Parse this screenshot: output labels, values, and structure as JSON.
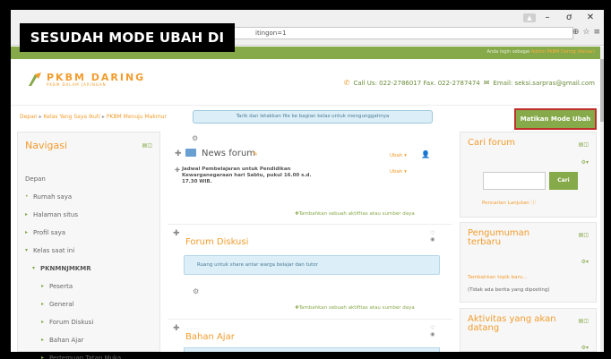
{
  "caption": "SESUDAH MODE UBAH DI KLIK",
  "browser": {
    "address_text": "itingon=1",
    "minimize": "–",
    "maximize": "ơ",
    "close": "✕"
  },
  "topbar": {
    "login_prefix": "Anda login sebagai",
    "login_user": "Admin PKBM Daring (Keluar)"
  },
  "header": {
    "logo_title": "PKBM DARING",
    "logo_subtitle": "PKBM DALAM JARINGAN",
    "contact": "Call Us: 022-2786017 Fax. 022-2787474",
    "email": "Email: seksi.sarpras@gmail.com"
  },
  "breadcrumb": {
    "items": [
      "Depan",
      "Kelas Yang Saya Ikuti",
      "PKBM Menuju Makmur"
    ]
  },
  "drop_hint": "Tarik dan letakkan file ke bagian kelas untuk mengunggahnya",
  "edit_button": "Matikan Mode Ubah",
  "nav": {
    "title": "Navigasi",
    "items": [
      {
        "label": "Depan",
        "level": 0
      },
      {
        "label": "Rumah saya",
        "level": 1
      },
      {
        "label": "Halaman situs",
        "level": 1
      },
      {
        "label": "Profil saya",
        "level": 1
      },
      {
        "label": "Kelas saat ini",
        "level": 1
      },
      {
        "label": "PKNMNJMKMR",
        "level": 2
      },
      {
        "label": "Peserta",
        "level": 3
      },
      {
        "label": "General",
        "level": 3
      },
      {
        "label": "Forum Diskusi",
        "level": 3
      },
      {
        "label": "Bahan Ajar",
        "level": 3
      },
      {
        "label": "Pertemuan Tatap Muka",
        "level": 3
      }
    ]
  },
  "main": {
    "news_forum": "News forum",
    "ubah": "Ubah",
    "schedule": "Jadwal Pembelajaran untuk Pendidikan Kewarganegaraan hari Sabtu, pukul 16.00 s.d. 17.30 WIB.",
    "add_activity": "Tambahkan sebuah aktifitas atau sumber daya",
    "section2_title": "Forum Diskusi",
    "section2_summary": "Ruang untuk share antar warga belajar dan tutor",
    "section3_title": "Bahan Ajar"
  },
  "right": {
    "search_title": "Cari forum",
    "search_button": "Cari",
    "advanced_search": "Pencarian Lanjutan",
    "news_title": "Pengumuman terbaru",
    "add_topic": "Tambahkan topik baru...",
    "no_news": "(Tidak ada berita yang diposting)",
    "upcoming_title": "Aktivitas yang akan datang"
  }
}
